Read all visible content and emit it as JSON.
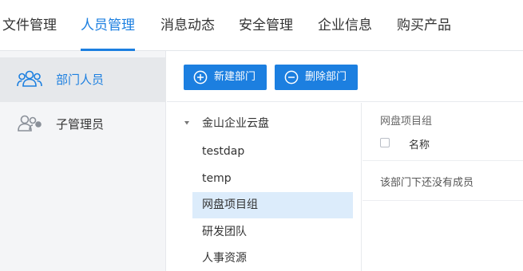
{
  "nav": {
    "tabs": [
      {
        "label": "文件管理"
      },
      {
        "label": "人员管理",
        "active": true
      },
      {
        "label": "消息动态"
      },
      {
        "label": "安全管理"
      },
      {
        "label": "企业信息"
      },
      {
        "label": "购买产品"
      }
    ]
  },
  "sidebar": {
    "items": [
      {
        "label": "部门人员",
        "icon": "department-users-icon",
        "active": true
      },
      {
        "label": "子管理员",
        "icon": "sub-admin-icon"
      }
    ]
  },
  "toolbar": {
    "new_dept_label": "新建部门",
    "delete_dept_label": "删除部门"
  },
  "tree": {
    "root": {
      "label": "金山企业云盘",
      "expanded": true
    },
    "nodes": [
      {
        "label": "testdap"
      },
      {
        "label": "temp"
      },
      {
        "label": "网盘项目组",
        "selected": true
      },
      {
        "label": "研发团队"
      },
      {
        "label": "人事资源"
      }
    ]
  },
  "detail": {
    "title": "网盘项目组",
    "column_name": "名称",
    "empty_text": "该部门下还没有成员"
  },
  "colors": {
    "accent": "#1c7fe0",
    "selected_bg": "#dcecfb",
    "sidebar_bg": "#f4f5f7"
  }
}
